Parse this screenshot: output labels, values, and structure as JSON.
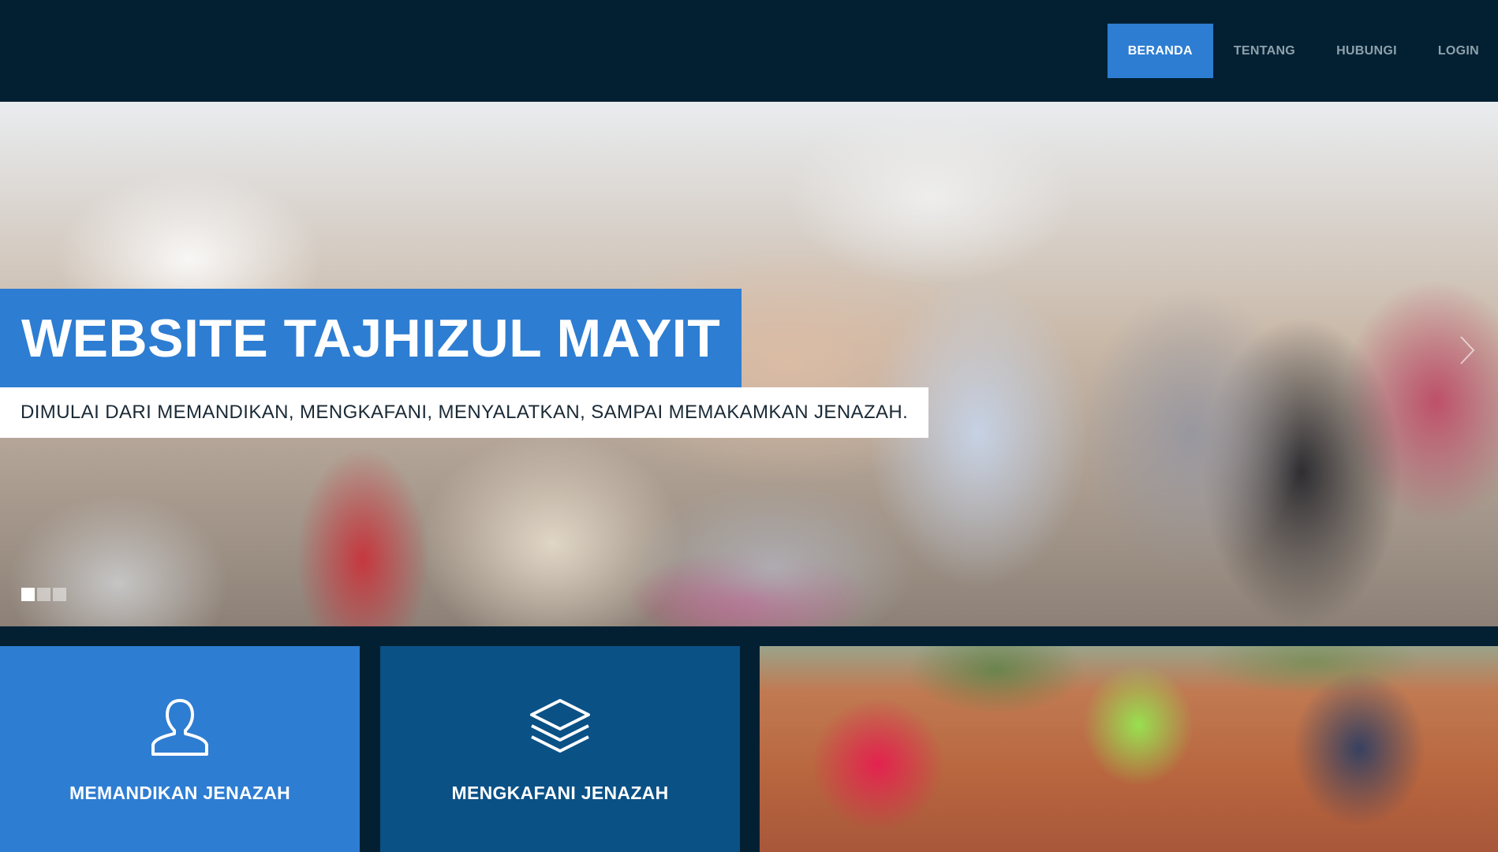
{
  "nav": {
    "items": [
      {
        "label": "BERANDA"
      },
      {
        "label": "TENTANG"
      },
      {
        "label": "HUBUNGI"
      },
      {
        "label": "LOGIN"
      }
    ],
    "active_index": 0
  },
  "hero": {
    "title": "WEBSITE TAJHIZUL MAYIT",
    "subtitle": "DIMULAI DARI MEMANDIKAN, MENGKAFANI, MENYALATKAN, SAMPAI MEMAKAMKAN JENAZAH.",
    "slide_count": 3,
    "active_slide": 1
  },
  "services": [
    {
      "label": "MEMANDIKAN JENAZAH",
      "icon": "user-icon"
    },
    {
      "label": "MENGKAFANI JENAZAH",
      "icon": "layers-icon"
    }
  ],
  "colors": {
    "background": "#022032",
    "accent": "#2d7dd2",
    "accent_dark": "#0a5186",
    "nav_text": "#8fa1ac"
  }
}
